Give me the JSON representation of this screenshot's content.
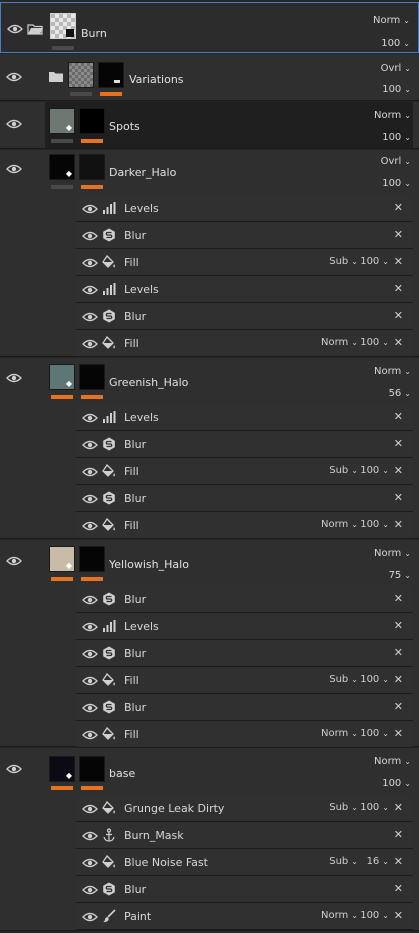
{
  "colors": {
    "accent_orange": "#e8731f",
    "selection_blue": "#4a7fc8",
    "panel_bg": "#2f2f2f"
  },
  "layers": [
    {
      "name": "Burn",
      "blend": "Norm",
      "opacity": "100"
    },
    {
      "name": "Variations",
      "blend": "Ovrl",
      "opacity": "100"
    },
    {
      "name": "Spots",
      "blend": "Norm",
      "opacity": "100"
    },
    {
      "name": "Darker_Halo",
      "blend": "Ovrl",
      "opacity": "100",
      "effects": [
        {
          "icon": "levels-icon",
          "name": "Levels"
        },
        {
          "icon": "blur-icon",
          "name": "Blur"
        },
        {
          "icon": "fill-icon",
          "name": "Fill",
          "blend": "Sub",
          "opacity": "100"
        },
        {
          "icon": "levels-icon",
          "name": "Levels"
        },
        {
          "icon": "blur-icon",
          "name": "Blur"
        },
        {
          "icon": "fill-icon",
          "name": "Fill",
          "blend": "Norm",
          "opacity": "100"
        }
      ]
    },
    {
      "name": "Greenish_Halo",
      "blend": "Norm",
      "opacity": "56",
      "effects": [
        {
          "icon": "levels-icon",
          "name": "Levels"
        },
        {
          "icon": "blur-icon",
          "name": "Blur"
        },
        {
          "icon": "fill-icon",
          "name": "Fill",
          "blend": "Sub",
          "opacity": "100"
        },
        {
          "icon": "blur-icon",
          "name": "Blur"
        },
        {
          "icon": "fill-icon",
          "name": "Fill",
          "blend": "Norm",
          "opacity": "100"
        }
      ]
    },
    {
      "name": "Yellowish_Halo",
      "blend": "Norm",
      "opacity": "75",
      "effects": [
        {
          "icon": "blur-icon",
          "name": "Blur"
        },
        {
          "icon": "levels-icon",
          "name": "Levels"
        },
        {
          "icon": "blur-icon",
          "name": "Blur"
        },
        {
          "icon": "fill-icon",
          "name": "Fill",
          "blend": "Sub",
          "opacity": "100"
        },
        {
          "icon": "blur-icon",
          "name": "Blur"
        },
        {
          "icon": "fill-icon",
          "name": "Fill",
          "blend": "Norm",
          "opacity": "100"
        }
      ]
    },
    {
      "name": "base",
      "blend": "Norm",
      "opacity": "100",
      "effects": [
        {
          "icon": "fill-icon",
          "name": "Grunge Leak Dirty",
          "blend": "Sub",
          "opacity": "100"
        },
        {
          "icon": "anchor-icon",
          "name": "Burn_Mask"
        },
        {
          "icon": "fill-icon",
          "name": "Blue Noise Fast",
          "blend": "Sub",
          "opacity": "16"
        },
        {
          "icon": "blur-icon",
          "name": "Blur"
        },
        {
          "icon": "brush-icon",
          "name": "Paint",
          "blend": "Norm",
          "opacity": "100"
        }
      ]
    }
  ],
  "glyphs": {
    "chevron": "⌄",
    "close": "✕"
  }
}
